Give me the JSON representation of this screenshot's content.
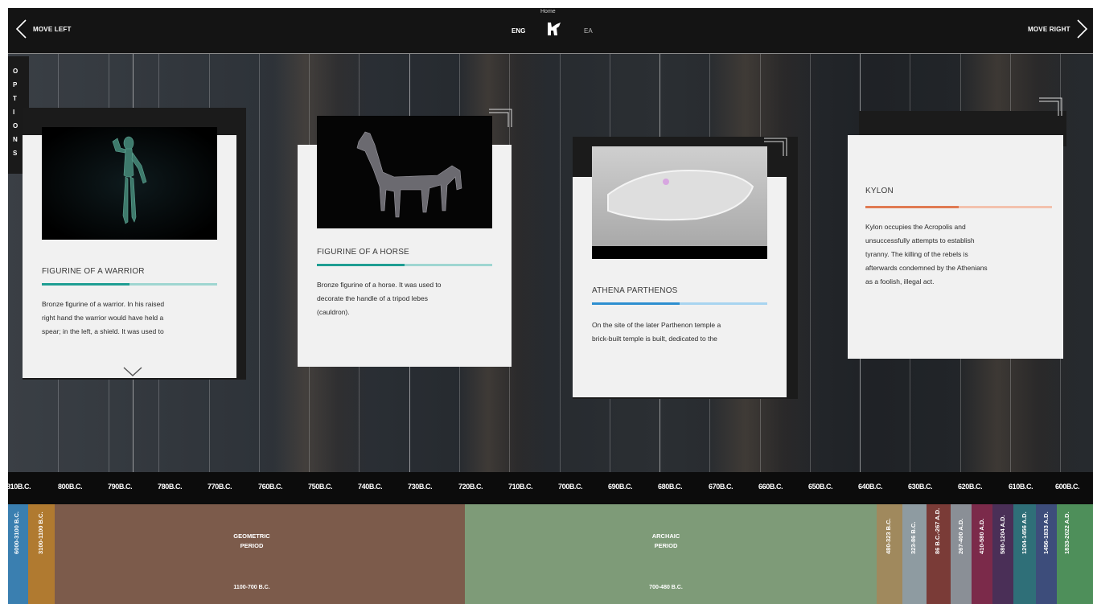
{
  "topbar": {
    "move_left": "MOVE LEFT",
    "move_right": "MOVE RIGHT",
    "home": "Home",
    "lang_eng": "ENG",
    "lang_ea": "EA"
  },
  "options": {
    "letters": [
      "O",
      "P",
      "T",
      "I",
      "O",
      "N",
      "S"
    ]
  },
  "cards": [
    {
      "title": "FIGURINE OF A WARRIOR",
      "text_lines": [
        "Bronze figurine of a warrior. In his raised",
        "right hand the warrior would have held a",
        "spear; in the left, a shield. It was used to"
      ],
      "accent": "#1f9e93",
      "progress": 0.5,
      "image": "bronze-warrior-figurine"
    },
    {
      "title": "FIGURINE OF A HORSE",
      "text_lines": [
        "Bronze figurine of a horse. It was used to",
        "decorate the handle of a tripod lebes",
        "(cauldron)."
      ],
      "accent": "#1f9e93",
      "progress": 0.5,
      "image": "bronze-horse-figurine"
    },
    {
      "title": "ATHENA PARTHENOS",
      "text_lines": [
        "On the site of the later Parthenon temple a",
        "brick-built temple is built, dedicated to the"
      ],
      "accent": "#2e8fd0",
      "progress": 0.5,
      "image": "acropolis-model"
    },
    {
      "title": "KYLON",
      "text_lines": [
        "Kylon occupies the Acropolis and",
        "unsuccessfully attempts to establish",
        "tyranny. The killing of the rebels is",
        "afterwards condemned by the Athenians",
        "as a foolish, illegal act."
      ],
      "accent": "#e07a52",
      "progress": 0.5,
      "image": ""
    }
  ],
  "timeline": {
    "ticks": [
      "810B.C.",
      "800B.C.",
      "790B.C.",
      "780B.C.",
      "770B.C.",
      "760B.C.",
      "750B.C.",
      "740B.C.",
      "730B.C.",
      "720B.C.",
      "710B.C.",
      "700B.C.",
      "690B.C.",
      "680B.C.",
      "670B.C.",
      "660B.C.",
      "650B.C.",
      "640B.C.",
      "630B.C.",
      "620B.C.",
      "610B.C.",
      "600B.C."
    ]
  },
  "periods": {
    "geometric": {
      "name1": "GEOMETRIC",
      "name2": "PERIOD",
      "range": "1100-700 B.C.",
      "color": "#7c5b4b"
    },
    "archaic": {
      "name1": "ARCHAIC",
      "name2": "PERIOD",
      "range": "700-480 B.C.",
      "color": "#7e9b78"
    },
    "left": [
      {
        "label": "6000-3100 B.C.",
        "color": "#3a7fb0"
      },
      {
        "label": "3100-1100 B.C.",
        "color": "#b07a30"
      }
    ],
    "right": [
      {
        "label": "480-323 B.C.",
        "color": "#a0895d"
      },
      {
        "label": "323-86 B.C.",
        "color": "#8e9ba1"
      },
      {
        "label": "86 B.C.-267 A.D.",
        "color": "#7a3b37"
      },
      {
        "label": "267-400 A.D.",
        "color": "#8a8f96"
      },
      {
        "label": "410-580 A.D.",
        "color": "#7b2a4a"
      },
      {
        "label": "580-1204 A.D.",
        "color": "#4a2f57"
      },
      {
        "label": "1204-1456 A.D.",
        "color": "#2f6f78"
      },
      {
        "label": "1456-1833 A.D.",
        "color": "#3d4d7b"
      },
      {
        "label": "1833-2022 A.D.",
        "color": "#4e8f5a"
      }
    ]
  }
}
